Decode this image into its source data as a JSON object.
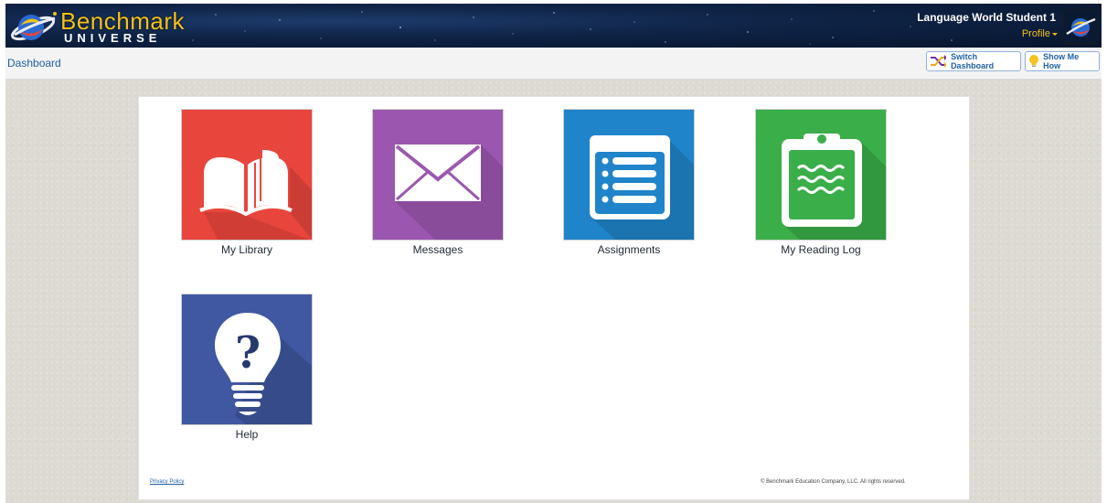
{
  "header": {
    "brand_name": "Benchmark",
    "brand_sub": "UNIVERSE",
    "user_name": "Language World Student 1",
    "profile_label": "Profile"
  },
  "toolbar": {
    "breadcrumb": "Dashboard",
    "switch_dashboard_label": "Switch Dashboard",
    "show_me_how_label": "Show Me How"
  },
  "tiles": [
    {
      "label": "My Library",
      "icon": "open-book-icon",
      "color": "#e8453c"
    },
    {
      "label": "Messages",
      "icon": "envelope-icon",
      "color": "#9b57b0"
    },
    {
      "label": "Assignments",
      "icon": "list-icon",
      "color": "#1f84c9"
    },
    {
      "label": "My Reading Log",
      "icon": "clipboard-icon",
      "color": "#3aae48"
    },
    {
      "label": "Help",
      "icon": "lightbulb-question-icon",
      "color": "#3f58a1"
    }
  ],
  "footer": {
    "privacy_label": "Privacy Policy",
    "copyright": "© Benchmark Education Company, LLC. All rights reserved."
  }
}
